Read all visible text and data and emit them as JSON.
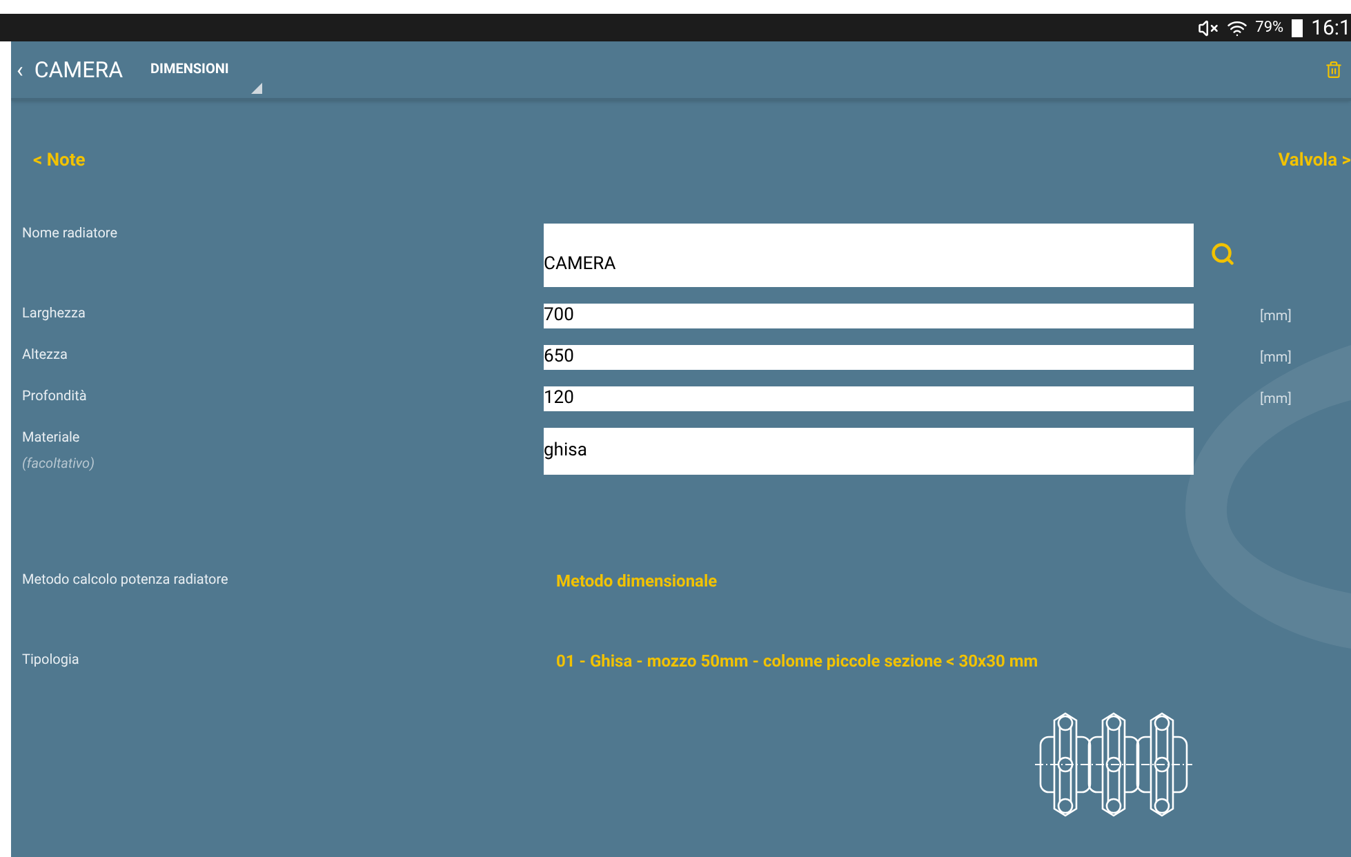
{
  "status_bar": {
    "battery_text": "79%",
    "time": "16:1"
  },
  "app_bar": {
    "back": "‹",
    "title": "CAMERA",
    "section": "DIMENSIONI"
  },
  "nav": {
    "prev": "< Note",
    "next": "Valvola >"
  },
  "fields": [
    {
      "label": "Nome radiatore",
      "value": "CAMERA",
      "kind": "search"
    },
    {
      "label": "Larghezza",
      "value": "700",
      "unit": "[mm]",
      "kind": "unit"
    },
    {
      "label": "Altezza",
      "value": "650",
      "unit": "[mm]",
      "kind": "unit"
    },
    {
      "label": "Profondità",
      "value": "120",
      "unit": "[mm]",
      "kind": "unit"
    },
    {
      "label": "Materiale",
      "sublabel": "(facoltativo)",
      "value": "ghisa",
      "kind": "tall"
    }
  ],
  "options": [
    {
      "label": "Metodo calcolo potenza radiatore",
      "value": "Metodo dimensionale"
    },
    {
      "label": "Tipologia",
      "value": "01 - Ghisa - mozzo 50mm - colonne piccole sezione < 30x30 mm"
    }
  ]
}
